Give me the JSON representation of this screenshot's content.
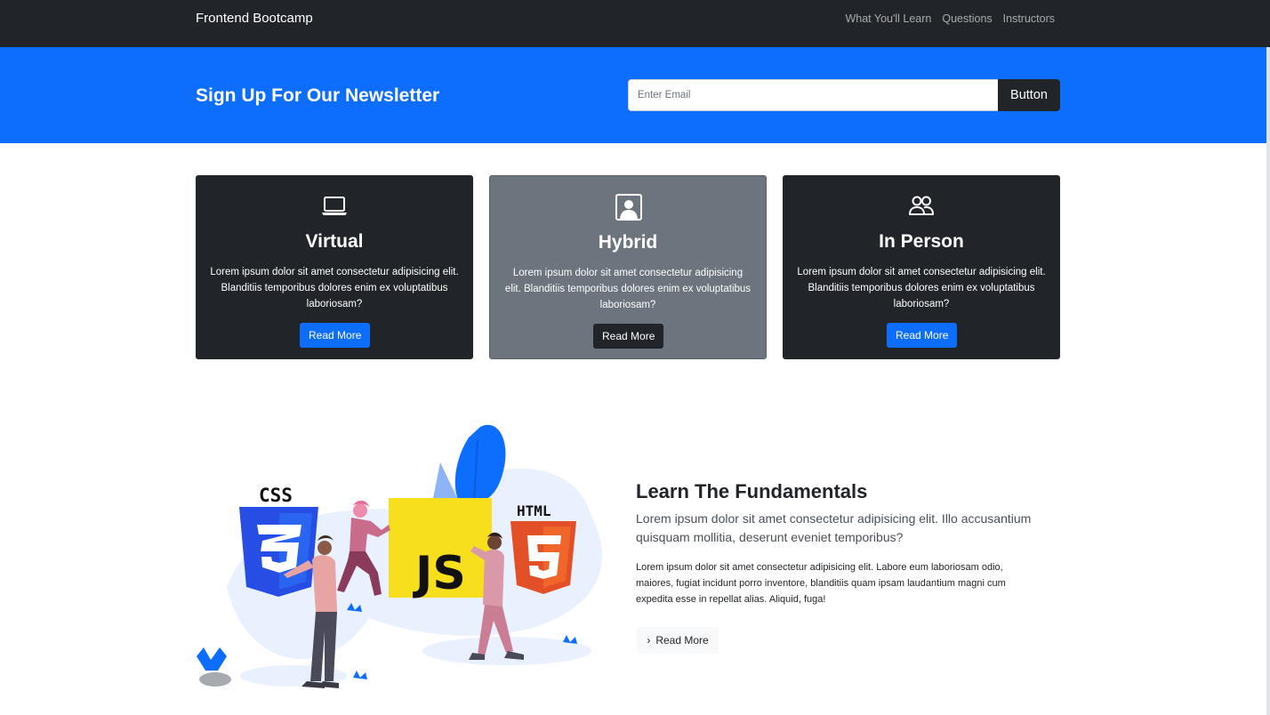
{
  "navbar": {
    "brand": "Frontend Bootcamp",
    "links": [
      "What You'll Learn",
      "Questions",
      "Instructors"
    ]
  },
  "newsletter": {
    "title": "Sign Up For Our Newsletter",
    "email_placeholder": "Enter Email",
    "button_label": "Button"
  },
  "cards": [
    {
      "icon": "laptop-icon",
      "title": "Virtual",
      "text": "Lorem ipsum dolor sit amet consectetur adipisicing elit. Blanditiis temporibus dolores enim ex voluptatibus laboriosam?",
      "button": "Read More"
    },
    {
      "icon": "person-square-icon",
      "title": "Hybrid",
      "text": "Lorem ipsum dolor sit amet consectetur adipisicing elit. Blanditiis temporibus dolores enim ex voluptatibus laboriosam?",
      "button": "Read More"
    },
    {
      "icon": "people-icon",
      "title": "In Person",
      "text": "Lorem ipsum dolor sit amet consectetur adipisicing elit. Blanditiis temporibus dolores enim ex voluptatibus laboriosam?",
      "button": "Read More"
    }
  ],
  "illustration": {
    "css_label": "CSS",
    "js_label": "JS",
    "html_label": "HTML"
  },
  "learn": {
    "title": "Learn The Fundamentals",
    "lead": "Lorem ipsum dolor sit amet consectetur adipisicing elit. Illo accusantium quisquam mollitia, deserunt eveniet temporibus?",
    "body": "Lorem ipsum dolor sit amet consectetur adipisicing elit. Labore eum laboriosam odio, maiores, fugiat incidunt porro inventore, blanditiis quam ipsam laudantium magni cum expedita esse in repellat alias. Aliquid, fuga!",
    "button": "Read More"
  },
  "colors": {
    "primary": "#0d6efd",
    "dark": "#212529",
    "secondary": "#6c757d",
    "light": "#f8f9fa",
    "js_yellow": "#f7df1e",
    "css_blue": "#264de4",
    "html_orange": "#e34f26"
  }
}
